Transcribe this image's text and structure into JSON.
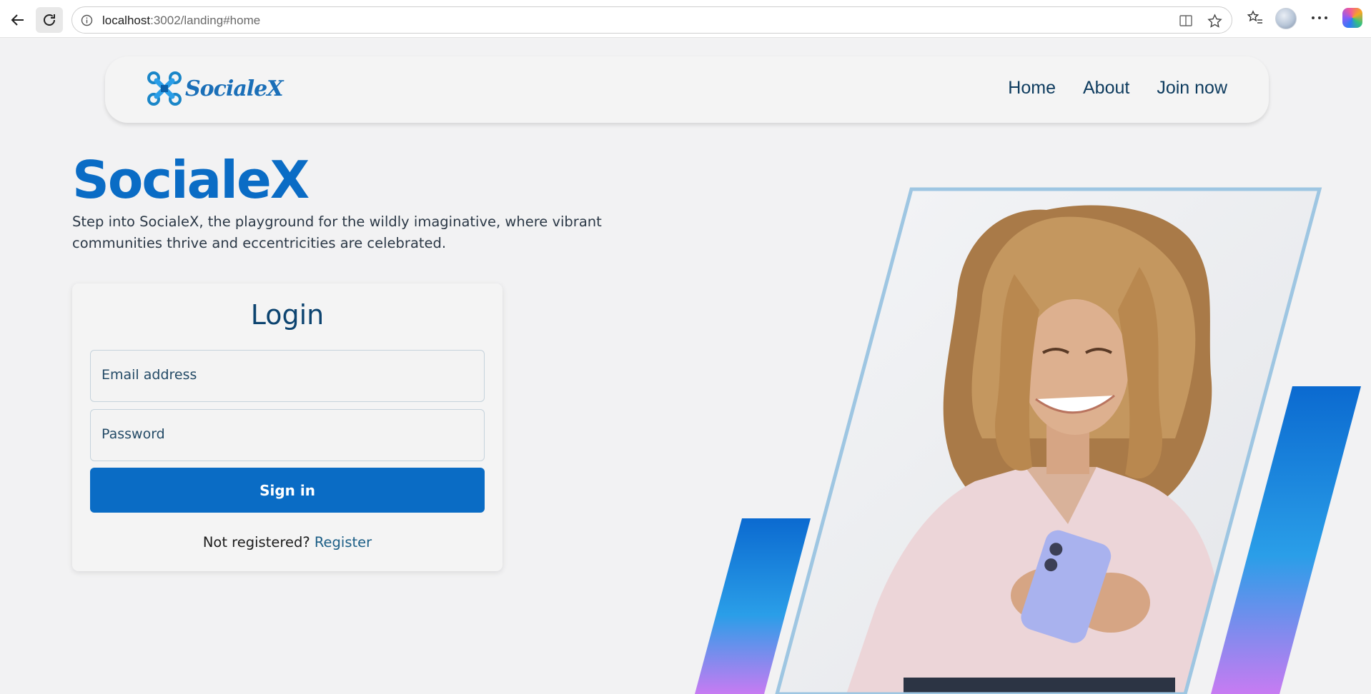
{
  "browser": {
    "url_host": "localhost",
    "url_rest": ":3002/landing#home",
    "icons": [
      "back-arrow-icon",
      "reload-icon",
      "site-info-icon",
      "split-screen-icon",
      "favorite-star-icon",
      "favorites-list-icon",
      "profile-avatar",
      "more-icon",
      "copilot-icon"
    ]
  },
  "nav": {
    "logo_text": "SocialeX",
    "links": [
      "Home",
      "About",
      "Join now"
    ]
  },
  "hero": {
    "title": "SocialeX",
    "subtitle": "Step into SocialeX, the playground for the wildly imaginative, where vibrant communities thrive and eccentricities are celebrated."
  },
  "login": {
    "title": "Login",
    "email_placeholder": "Email address",
    "password_placeholder": "Password",
    "submit_label": "Sign in",
    "register_prompt": "Not registered?",
    "register_link": "Register"
  },
  "colors": {
    "brand_blue": "#0a6cc5",
    "navy": "#0d3b5e",
    "stripe_gradient_top": "#0b6ad0",
    "stripe_gradient_mid": "#2a9ee8",
    "stripe_gradient_bottom": "#c77bf2",
    "frame_border": "#9ec6e2"
  }
}
